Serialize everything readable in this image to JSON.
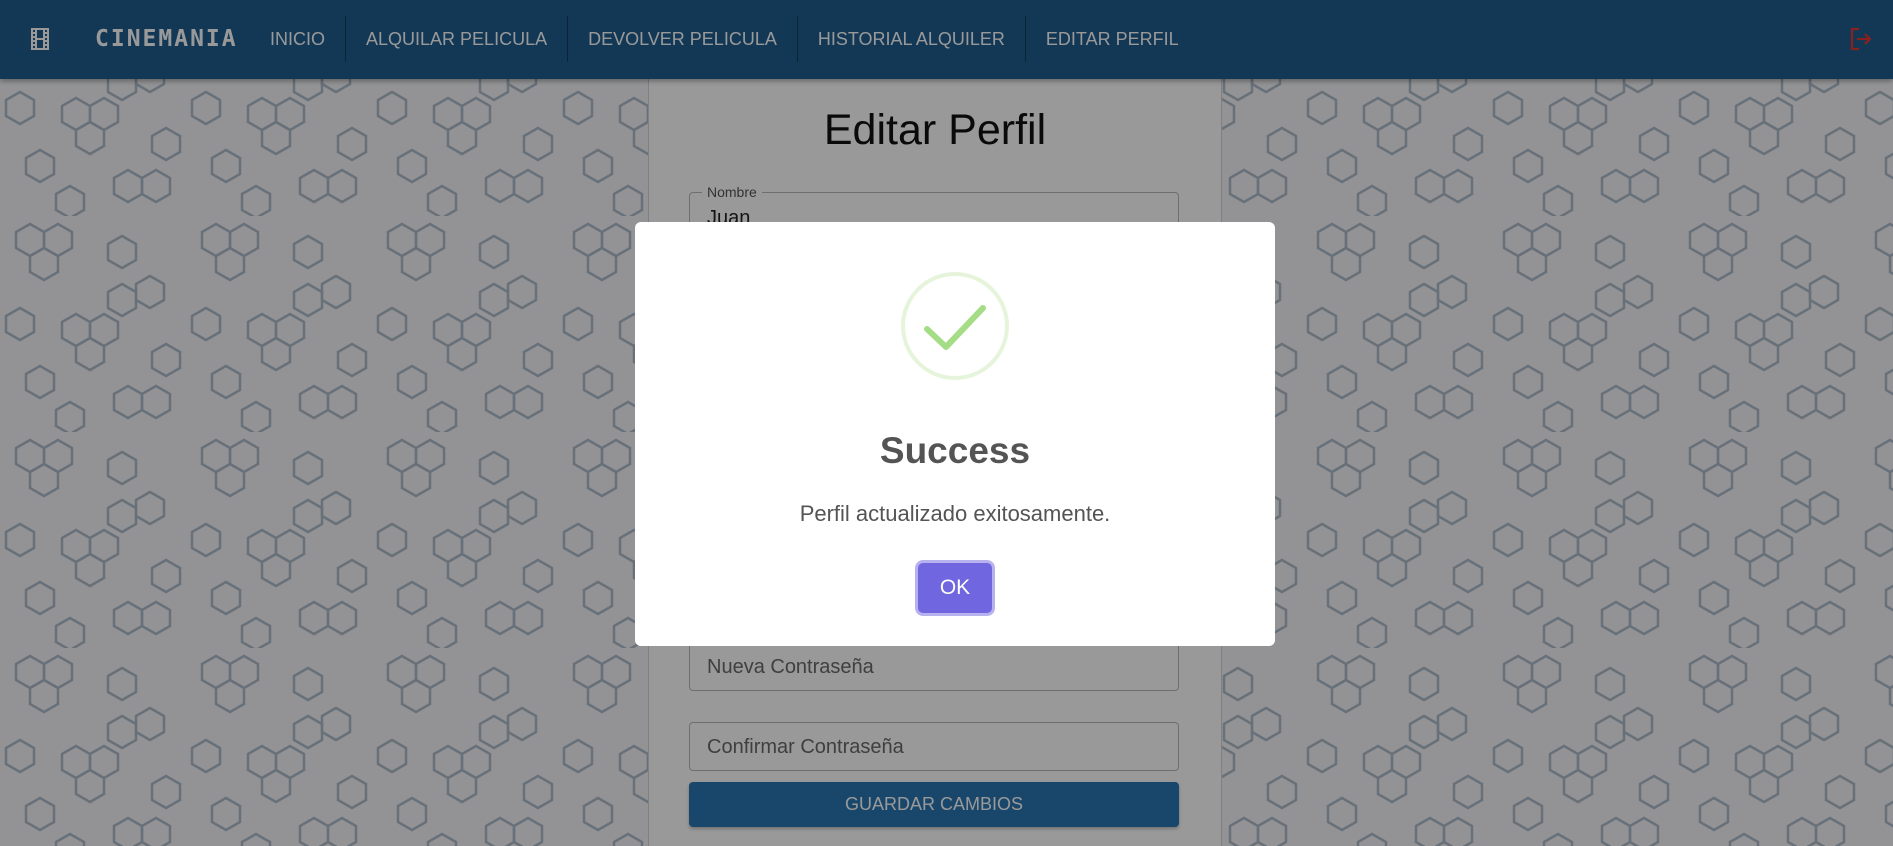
{
  "app": {
    "brand": "CINEMANIA",
    "icons": {
      "brand_icon": "film-icon",
      "logout_icon": "logout-icon"
    },
    "colors": {
      "appbar": "#1f5e8f",
      "logout": "#e53935",
      "save_button": "#2b77b3",
      "ok_button": "#7066e0",
      "success": "#a5dc86"
    }
  },
  "nav": {
    "items": [
      {
        "label": "INICIO"
      },
      {
        "label": "ALQUILAR PELICULA"
      },
      {
        "label": "DEVOLVER PELICULA"
      },
      {
        "label": "HISTORIAL ALQUILER"
      },
      {
        "label": "EDITAR PERFIL"
      }
    ]
  },
  "form": {
    "title": "Editar Perfil",
    "name_field": {
      "legend": "Nombre",
      "value": "Juan"
    },
    "new_password": {
      "placeholder": "Nueva Contraseña"
    },
    "confirm_password": {
      "placeholder": "Confirmar Contraseña"
    },
    "save_label": "GUARDAR CAMBIOS"
  },
  "dialog": {
    "icon": "checkmark-icon",
    "title": "Success",
    "message": "Perfil actualizado exitosamente.",
    "ok_label": "OK"
  }
}
